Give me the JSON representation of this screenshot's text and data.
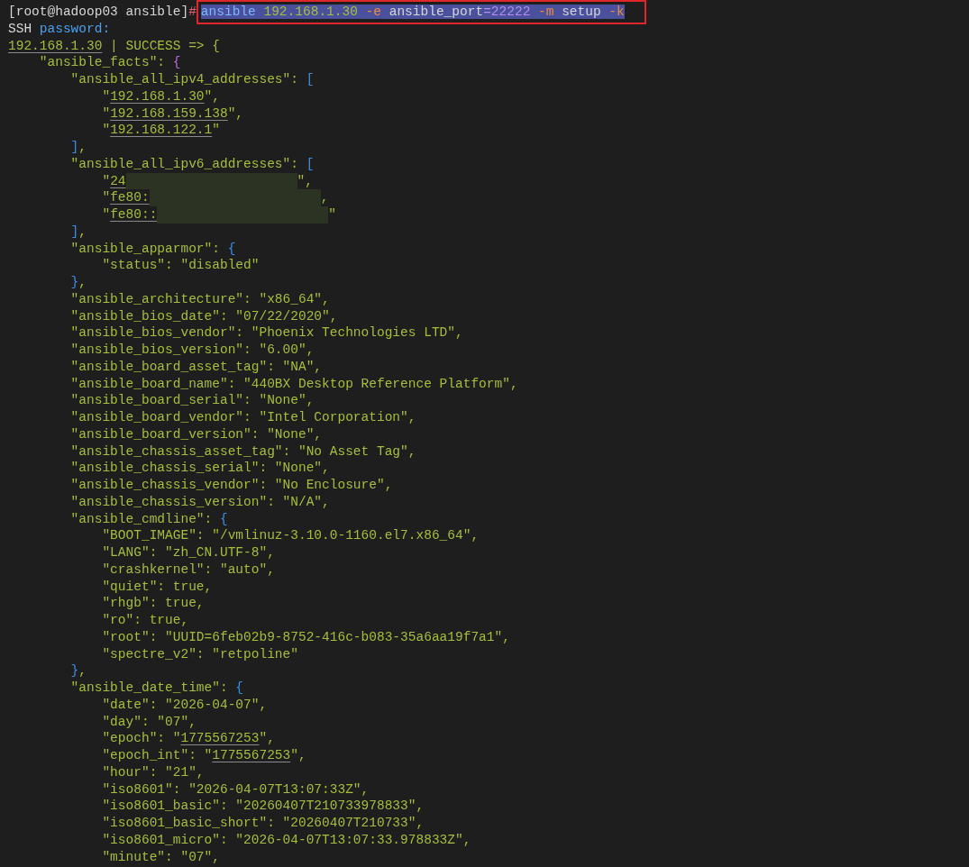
{
  "terminal": {
    "prompt": {
      "segments": [
        {
          "text": "[root@hadoop03 ansible]",
          "kind": "text"
        },
        {
          "text": "#",
          "kind": "symbol"
        }
      ],
      "command": {
        "selected": true,
        "boxed": true,
        "segments": [
          {
            "text": "ansible",
            "kind": "command"
          },
          {
            "text": " 192.168.1.30",
            "kind": "string"
          },
          {
            "text": " -e",
            "kind": "flag"
          },
          {
            "text": " ansible_port",
            "kind": "text"
          },
          {
            "text": "=22222",
            "kind": "number"
          },
          {
            "text": " -m",
            "kind": "flag"
          },
          {
            "text": " setup",
            "kind": "text"
          },
          {
            "text": " -k",
            "kind": "flag"
          }
        ]
      }
    },
    "lines": [
      [
        {
          "text": "SSH ",
          "kind": "text"
        },
        {
          "text": "password:",
          "kind": "label"
        }
      ],
      [
        {
          "text": "192.168.1.30",
          "kind": "link"
        },
        {
          "text": " | SUCCESS => {",
          "kind": "string"
        }
      ],
      [
        {
          "text": "    \"ansible_facts\": ",
          "kind": "string"
        },
        {
          "text": "{",
          "kind": "facts_brace"
        }
      ],
      [
        {
          "text": "        \"ansible_all_ipv4_addresses\": ",
          "kind": "string"
        },
        {
          "text": "[",
          "kind": "brace"
        }
      ],
      [
        {
          "text": "            \"",
          "kind": "string"
        },
        {
          "text": "192.168.1.30",
          "kind": "link"
        },
        {
          "text": "\",",
          "kind": "string"
        }
      ],
      [
        {
          "text": "            \"",
          "kind": "string"
        },
        {
          "text": "192.168.159.138",
          "kind": "link"
        },
        {
          "text": "\",",
          "kind": "string"
        }
      ],
      [
        {
          "text": "            \"",
          "kind": "string"
        },
        {
          "text": "192.168.122.1",
          "kind": "link"
        },
        {
          "text": "\"",
          "kind": "string"
        }
      ],
      [
        {
          "text": "        ]",
          "kind": "brace"
        },
        {
          "text": ",",
          "kind": "string"
        }
      ],
      [
        {
          "text": "        \"ansible_all_ipv6_addresses\": ",
          "kind": "string"
        },
        {
          "text": "[",
          "kind": "brace"
        }
      ],
      [
        {
          "text": "            \"",
          "kind": "string"
        },
        {
          "text": "24",
          "kind": "link"
        },
        {
          "kind": "mask"
        },
        {
          "text": "\",",
          "kind": "string"
        }
      ],
      [
        {
          "text": "            \"",
          "kind": "string"
        },
        {
          "text": "fe80:",
          "kind": "link"
        },
        {
          "kind": "mask"
        },
        {
          "text": ",",
          "kind": "string"
        }
      ],
      [
        {
          "text": "            \"",
          "kind": "string"
        },
        {
          "text": "fe80::",
          "kind": "link"
        },
        {
          "kind": "mask"
        },
        {
          "text": "\"",
          "kind": "string"
        }
      ],
      [
        {
          "text": "        ]",
          "kind": "brace"
        },
        {
          "text": ",",
          "kind": "string"
        }
      ],
      [
        {
          "text": "        \"ansible_apparmor\": ",
          "kind": "string"
        },
        {
          "text": "{",
          "kind": "brace"
        }
      ],
      [
        {
          "text": "            \"status\": \"disabled\"",
          "kind": "string"
        }
      ],
      [
        {
          "text": "        }",
          "kind": "brace"
        },
        {
          "text": ",",
          "kind": "string"
        }
      ],
      [
        {
          "text": "        \"ansible_architecture\": \"x86_64\",",
          "kind": "string"
        }
      ],
      [
        {
          "text": "        \"ansible_bios_date\": \"07/22/2020\",",
          "kind": "string"
        }
      ],
      [
        {
          "text": "        \"ansible_bios_vendor\": \"Phoenix Technologies LTD\",",
          "kind": "string"
        }
      ],
      [
        {
          "text": "        \"ansible_bios_version\": \"6.00\",",
          "kind": "string"
        }
      ],
      [
        {
          "text": "        \"ansible_board_asset_tag\": \"NA\",",
          "kind": "string"
        }
      ],
      [
        {
          "text": "        \"ansible_board_name\": \"440BX Desktop Reference Platform\",",
          "kind": "string"
        }
      ],
      [
        {
          "text": "        \"ansible_board_serial\": \"None\",",
          "kind": "string"
        }
      ],
      [
        {
          "text": "        \"ansible_board_vendor\": \"Intel Corporation\",",
          "kind": "string"
        }
      ],
      [
        {
          "text": "        \"ansible_board_version\": \"None\",",
          "kind": "string"
        }
      ],
      [
        {
          "text": "        \"ansible_chassis_asset_tag\": \"No Asset Tag\",",
          "kind": "string"
        }
      ],
      [
        {
          "text": "        \"ansible_chassis_serial\": \"None\",",
          "kind": "string"
        }
      ],
      [
        {
          "text": "        \"ansible_chassis_vendor\": \"No Enclosure\",",
          "kind": "string"
        }
      ],
      [
        {
          "text": "        \"ansible_chassis_version\": \"N/A\",",
          "kind": "string"
        }
      ],
      [
        {
          "text": "        \"ansible_cmdline\": ",
          "kind": "string"
        },
        {
          "text": "{",
          "kind": "brace"
        }
      ],
      [
        {
          "text": "            \"BOOT_IMAGE\": \"/vmlinuz-3.10.0-1160.el7.x86_64\",",
          "kind": "string"
        }
      ],
      [
        {
          "text": "            \"LANG\": \"zh_CN.UTF-8\",",
          "kind": "string"
        }
      ],
      [
        {
          "text": "            \"crashkernel\": \"auto\",",
          "kind": "string"
        }
      ],
      [
        {
          "text": "            \"quiet\": true,",
          "kind": "string"
        }
      ],
      [
        {
          "text": "            \"rhgb\": true,",
          "kind": "string"
        }
      ],
      [
        {
          "text": "            \"ro\": true,",
          "kind": "string"
        }
      ],
      [
        {
          "text": "            \"root\": \"UUID=6feb02b9-8752-416c-b083-35a6aa19f7a1\",",
          "kind": "string"
        }
      ],
      [
        {
          "text": "            \"spectre_v2\": \"retpoline\"",
          "kind": "string"
        }
      ],
      [
        {
          "text": "        }",
          "kind": "brace"
        },
        {
          "text": ",",
          "kind": "string"
        }
      ],
      [
        {
          "text": "        \"ansible_date_time\": ",
          "kind": "string"
        },
        {
          "text": "{",
          "kind": "brace"
        }
      ],
      [
        {
          "text": "            \"date\": \"2026-04-07\",",
          "kind": "string"
        }
      ],
      [
        {
          "text": "            \"day\": \"07\",",
          "kind": "string"
        }
      ],
      [
        {
          "text": "            \"epoch\": \"",
          "kind": "string"
        },
        {
          "text": "1775567253",
          "kind": "link"
        },
        {
          "text": "\",",
          "kind": "string"
        }
      ],
      [
        {
          "text": "            \"epoch_int\": \"",
          "kind": "string"
        },
        {
          "text": "1775567253",
          "kind": "link"
        },
        {
          "text": "\",",
          "kind": "string"
        }
      ],
      [
        {
          "text": "            \"hour\": \"21\",",
          "kind": "string"
        }
      ],
      [
        {
          "text": "            \"iso8601\": \"2026-04-07T13:07:33Z\",",
          "kind": "string"
        }
      ],
      [
        {
          "text": "            \"iso8601_basic\": \"20260407T210733978833\",",
          "kind": "string"
        }
      ],
      [
        {
          "text": "            \"iso8601_basic_short\": \"20260407T210733\",",
          "kind": "string"
        }
      ],
      [
        {
          "text": "            \"iso8601_micro\": \"2026-04-07T13:07:33.978833Z\",",
          "kind": "string"
        }
      ],
      [
        {
          "text": "            \"minute\": \"07\",",
          "kind": "string"
        }
      ]
    ]
  }
}
